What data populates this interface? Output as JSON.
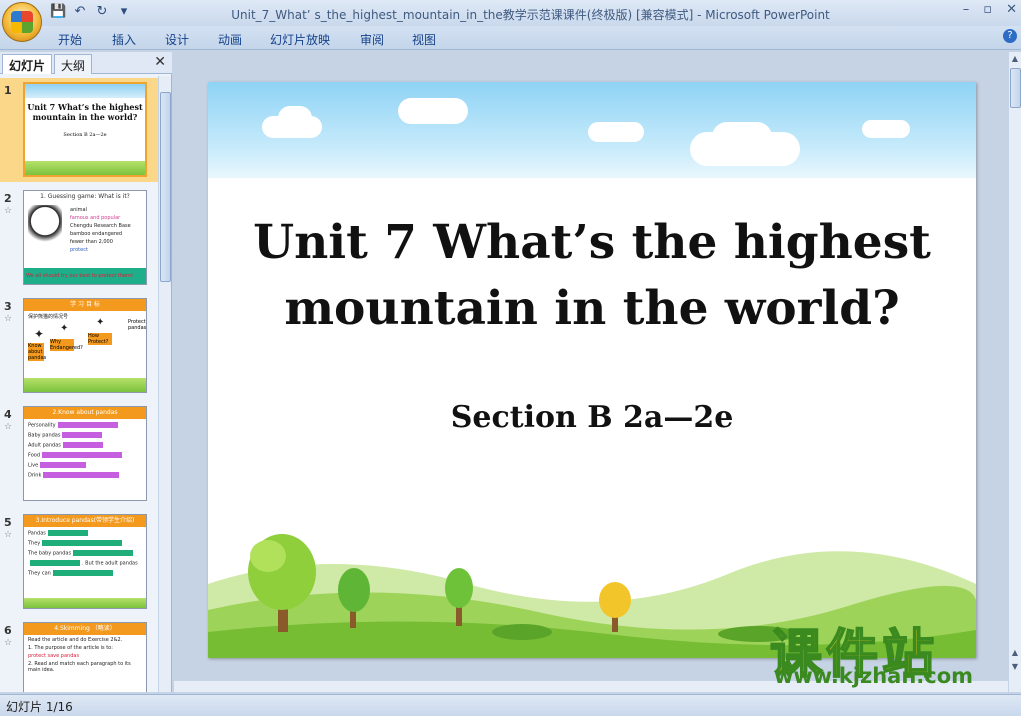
{
  "window": {
    "title": "Unit_7_What’ s_the_highest_mountain_in_the教学示范课课件(终极版) [兼容模式] - Microsoft PowerPoint",
    "controls": [
      "–",
      "▫",
      "✕"
    ]
  },
  "ribbon": {
    "tabs": [
      "开始",
      "插入",
      "设计",
      "动画",
      "幻灯片放映",
      "审阅",
      "视图"
    ],
    "help": "?"
  },
  "left_pane": {
    "tabs": [
      "幻灯片",
      "大纲"
    ],
    "close": "✕",
    "slides": [
      {
        "num": "1",
        "title": "Unit 7 What’s the highest mountain in the world?",
        "sub": "Section B  2a—2e"
      },
      {
        "num": "2",
        "title": "1. Guessing game: What is it?",
        "lines": [
          "animal",
          "famous and popular",
          "Chengdu Research Base",
          "bamboo  endangered",
          "fewer than 2,000",
          "protect"
        ],
        "footer": "We all should try our best to protect them!"
      },
      {
        "num": "3",
        "title": "学  习  目  标",
        "lines": [
          "保护熊猫的情况号",
          "Know about pandas",
          "Why Endangered?",
          "How Protect?",
          "Protect pandas"
        ]
      },
      {
        "num": "4",
        "title": "2.Know about pandas",
        "lines": [
          "Personality",
          "Baby pandas",
          "Adult pandas",
          "Food",
          "Live",
          "Drink"
        ]
      },
      {
        "num": "5",
        "title": "3.Introduce pandas(带领学生介绍)",
        "lines": [
          "Pandas",
          "They",
          "The baby pandas",
          ". But the adult pandas",
          "They can"
        ]
      },
      {
        "num": "6",
        "title": "4.Skimming （略读）",
        "lines": [
          "Read the article and do Exercise 2&2.",
          "1. The purpose of the article is to:",
          "protect save pandas",
          "2. Read and match each paragraph to its main idea."
        ]
      }
    ]
  },
  "slide": {
    "title": "Unit 7 What’s the highest mountain in the world?",
    "subtitle": "Section B  2a—2e"
  },
  "watermark": {
    "cn": "课件站",
    "url": "www.kjzhan.com"
  },
  "status": {
    "text": "幻灯片 1/16"
  }
}
